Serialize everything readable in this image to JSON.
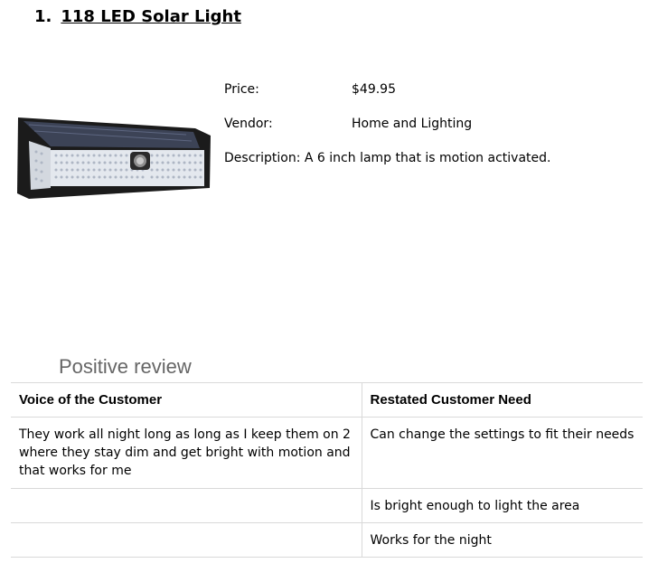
{
  "heading": {
    "number": "1.",
    "title": "118 LED Solar Light"
  },
  "product": {
    "image_icon": "solar-light-image",
    "price_label": "Price:",
    "price_value": "$49.95",
    "vendor_label": "Vendor:",
    "vendor_value": "Home and Lighting",
    "description_label": "Description:",
    "description_value": "A 6 inch lamp that is motion activated."
  },
  "review": {
    "section_title": "Positive review",
    "columns": [
      "Voice of the Customer",
      "Restated Customer Need"
    ],
    "rows": [
      {
        "voice": "They work all night long  as long as I keep them on 2 where they stay dim and get bright with motion and that works for me",
        "need": "Can change the settings to fit their needs"
      },
      {
        "voice": "",
        "need": "Is bright enough to light the area"
      },
      {
        "voice": "",
        "need": "Works for the night"
      }
    ]
  }
}
